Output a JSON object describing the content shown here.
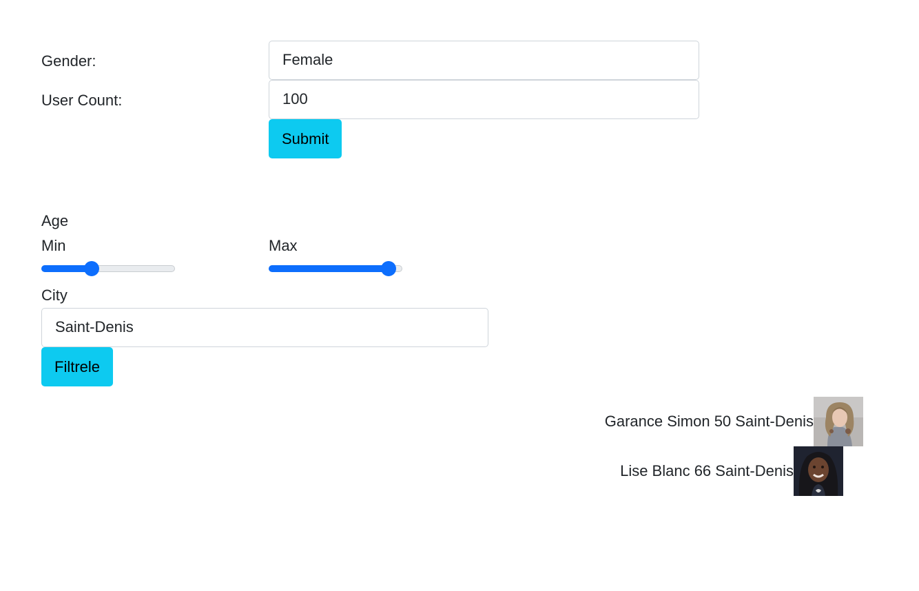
{
  "form": {
    "gender_label": "Gender:",
    "gender_value": "Female",
    "count_label": "User Count:",
    "count_value": "100",
    "submit_label": "Submit"
  },
  "filter": {
    "age_label": "Age",
    "min_label": "Min",
    "max_label": "Max",
    "min_level": 0.36,
    "max_level": 0.95,
    "city_label": "City",
    "city_value": "Saint-Denis",
    "filter_label": "Filtrele"
  },
  "results": [
    {
      "text": "Garance Simon 50 Saint-Denis",
      "avatar": "woman-avatar-light-hair"
    },
    {
      "text": "Lise Blanc 66 Saint-Denis",
      "avatar": "woman-avatar-dark-hair"
    }
  ],
  "colors": {
    "accent": "#0dcaf0",
    "slider": "#0d6efd"
  }
}
